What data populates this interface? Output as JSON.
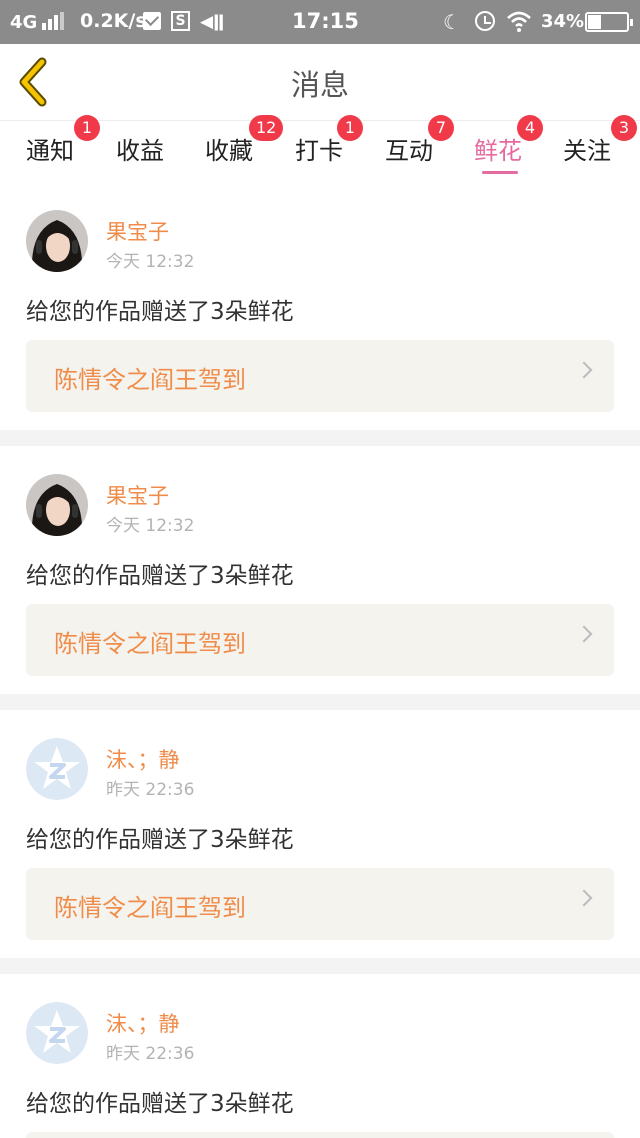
{
  "status_bar": {
    "network": "4G",
    "speed": "0.2K/s",
    "time": "17:15",
    "battery_percent": "34%",
    "battery_level": 0.34,
    "icons": [
      "signal-icon",
      "message-icon",
      "s-icon",
      "vibrate-icon",
      "moon-icon",
      "alarm-icon",
      "wifi-icon",
      "battery-icon"
    ]
  },
  "header": {
    "title": "消息",
    "back_icon": "chevron-left-icon"
  },
  "tabs": [
    {
      "label": "通知",
      "badge": "1"
    },
    {
      "label": "收益",
      "badge": ""
    },
    {
      "label": "收藏",
      "badge": "12"
    },
    {
      "label": "打卡",
      "badge": "1"
    },
    {
      "label": "互动",
      "badge": "7"
    },
    {
      "label": "鲜花",
      "badge": "4",
      "active": true
    },
    {
      "label": "关注",
      "badge": "3"
    }
  ],
  "messages": [
    {
      "user": "果宝子",
      "time": "今天 12:32",
      "text": "给您的作品赠送了3朵鲜花",
      "work_title": "陈情令之阎王驾到",
      "avatar": "photo-avatar"
    },
    {
      "user": "果宝子",
      "time": "今天 12:32",
      "text": "给您的作品赠送了3朵鲜花",
      "work_title": "陈情令之阎王驾到",
      "avatar": "photo-avatar"
    },
    {
      "user": "沫、；静",
      "time": "昨天 22:36",
      "text": "给您的作品赠送了3朵鲜花",
      "work_title": "陈情令之阎王驾到",
      "avatar": "default-avatar"
    },
    {
      "user": "沫、；静",
      "time": "昨天 22:36",
      "text": "给您的作品赠送了3朵鲜花",
      "work_title": "",
      "avatar": "default-avatar"
    }
  ],
  "colors": {
    "accent_pink": "#e46aa0",
    "name_orange": "#f08c4a",
    "badge_red": "#f03a4a",
    "back_yellow": "#f5c400"
  }
}
